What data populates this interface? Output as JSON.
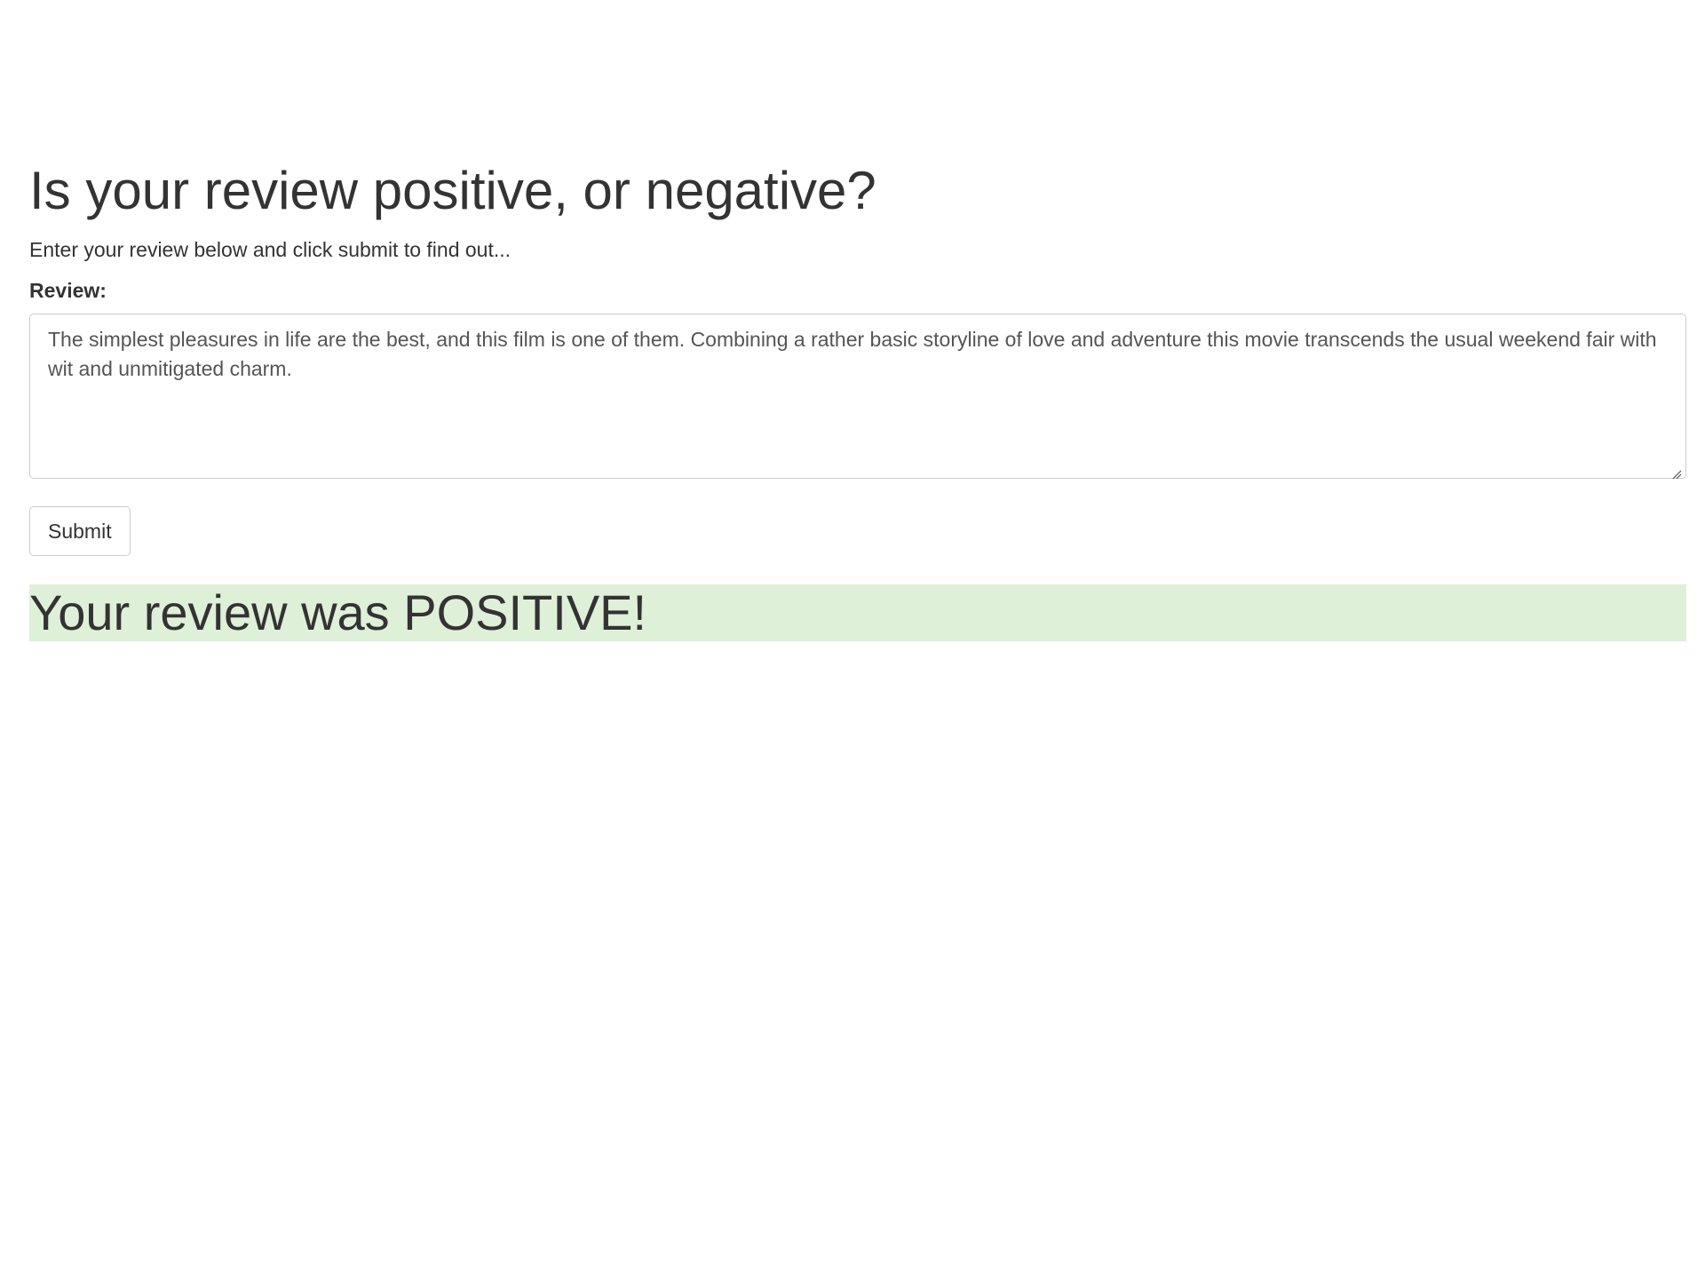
{
  "page": {
    "heading": "Is your review positive, or negative?",
    "subtitle": "Enter your review below and click submit to find out..."
  },
  "form": {
    "review_label": "Review:",
    "review_text": "The simplest pleasures in life are the best, and this film is one of them. Combining a rather basic storyline of love and adventure this movie transcends the usual weekend fair with wit and unmitigated charm.",
    "submit_label": "Submit"
  },
  "result": {
    "text": "Your review was POSITIVE!",
    "background_color": "#dff0d8"
  },
  "icons": {
    "resize_grip": "resize-grip-icon"
  }
}
